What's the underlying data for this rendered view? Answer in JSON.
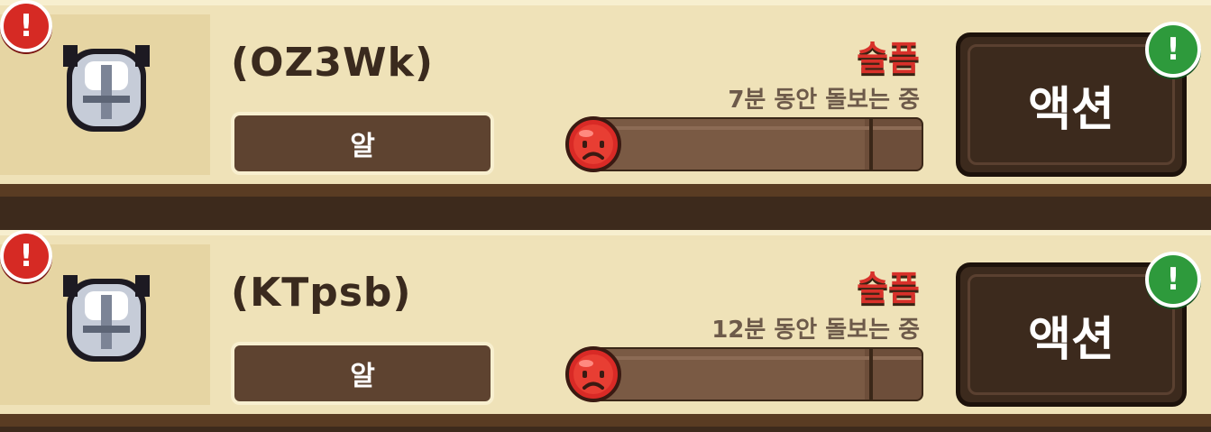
{
  "pets": [
    {
      "name": "(OZ3Wk)",
      "stage": "알",
      "mood": "슬픔",
      "care_time": "7분 동안 돌보는 중",
      "mood_level": 0.83,
      "action_label": "액션",
      "alert_icon": "exclamation-icon",
      "action_badge_icon": "exclamation-icon"
    },
    {
      "name": "(KTpsb)",
      "stage": "알",
      "mood": "슬픔",
      "care_time": "12분 동안 돌보는 중",
      "mood_level": 0.83,
      "action_label": "액션",
      "alert_icon": "exclamation-icon",
      "action_badge_icon": "exclamation-icon"
    }
  ],
  "colors": {
    "card_bg": "#efe2b8",
    "alert_red": "#d62a24",
    "action_green": "#2e9a3c",
    "mood_red": "#d8312a",
    "button_brown": "#3c2a1d"
  }
}
